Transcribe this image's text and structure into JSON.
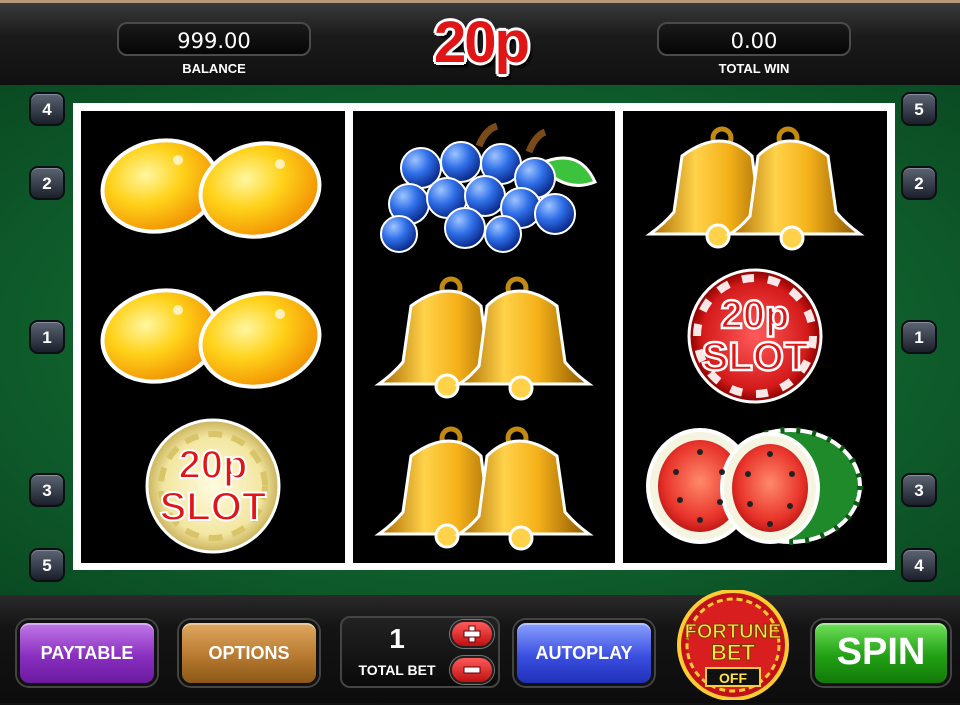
{
  "header": {
    "balance_value": "999.00",
    "balance_label": "BALANCE",
    "title": "20p SLOT",
    "total_win_value": "0.00",
    "total_win_label": "TOTAL WIN"
  },
  "paylines": {
    "left": [
      "4",
      "2",
      "1",
      "3",
      "5"
    ],
    "right": [
      "5",
      "2",
      "1",
      "3",
      "4"
    ]
  },
  "reels": [
    [
      "lemons-icon",
      "lemons-icon",
      "20p-slot-chip-gold-icon"
    ],
    [
      "blue-grapes-icon",
      "golden-bells-icon",
      "golden-bells-icon"
    ],
    [
      "golden-bells-icon",
      "20p-slot-chip-red-icon",
      "watermelon-icon"
    ]
  ],
  "chip_text": {
    "line1": "20p",
    "line2": "SLOT"
  },
  "controls": {
    "paytable_label": "PAYTABLE",
    "options_label": "OPTIONS",
    "bet_value": "1",
    "bet_label": "TOTAL BET",
    "autoplay_label": "AUTOPLAY",
    "fortune_line1": "FORTUNE",
    "fortune_line2": "BET",
    "fortune_state": "OFF",
    "spin_label": "SPIN"
  },
  "colors": {
    "felt": "#0e5a2a",
    "title_red": "#e01515",
    "paytable": "#8a2fc0",
    "options": "#b77a30",
    "autoplay": "#3b4fe0",
    "spin": "#22a014"
  }
}
